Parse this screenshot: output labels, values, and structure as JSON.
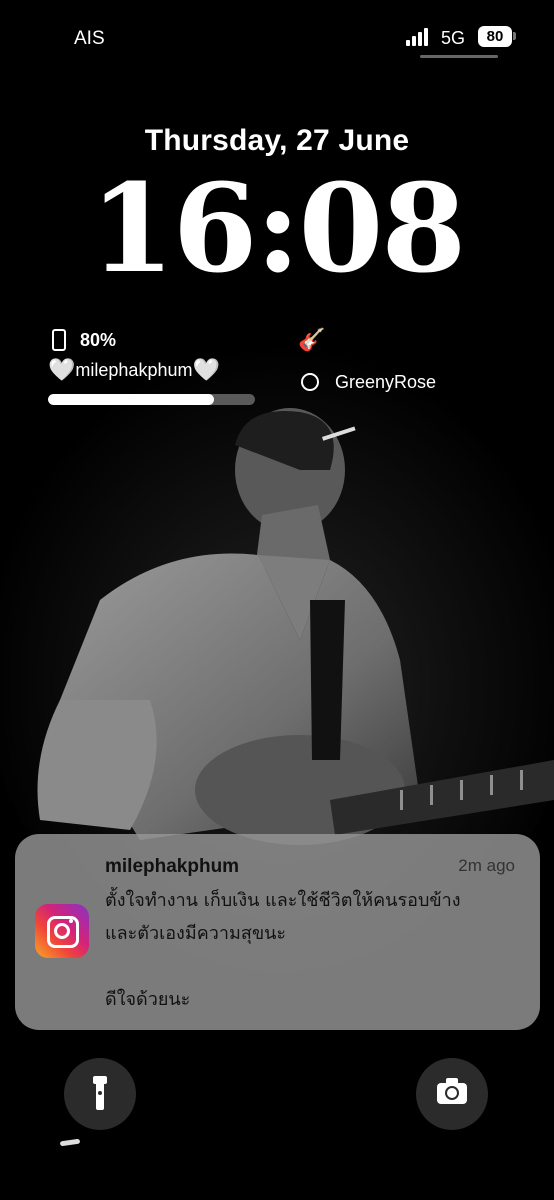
{
  "status_bar": {
    "carrier": "AIS",
    "network": "5G",
    "battery_level": "80",
    "signal_icon": "signal-bars-icon"
  },
  "lock_screen": {
    "date": "Thursday, 27 June",
    "time": "16:08"
  },
  "widgets": {
    "battery": {
      "icon": "phone-battery-icon",
      "percent_text": "80%",
      "device_name": "milephakphum",
      "heart_glyph": "🤍",
      "level": 0.8
    },
    "right": {
      "icon": "guitar-icon",
      "alarm_icon": "circle-icon",
      "label": "GreenyRose"
    }
  },
  "notification": {
    "app_icon": "instagram-icon",
    "title": "milephakphum",
    "time": "2m ago",
    "body": "ตั้งใจทำงาน เก็บเงิน และใช้ชีวิตให้คนรอบข้าง\nและตัวเองมีความสุขนะ\n\nดีใจด้วยนะ"
  },
  "quick_actions": {
    "flashlight_icon": "flashlight-icon",
    "camera_icon": "camera-icon"
  },
  "colors": {
    "background": "#000000",
    "notification_bg": "#969696",
    "progress_track": "#5a5a5a",
    "progress_fill": "#ffffff"
  }
}
